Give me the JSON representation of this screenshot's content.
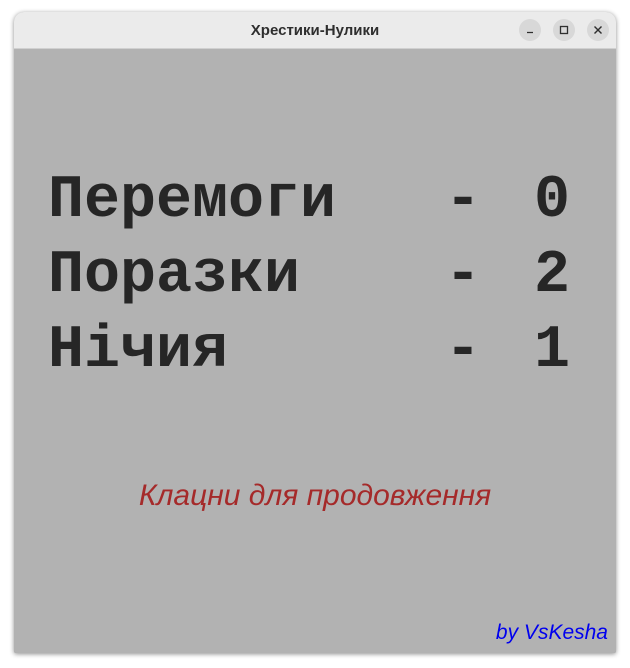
{
  "window": {
    "title": "Хрестики-Нулики"
  },
  "stats": [
    {
      "label": "Перемоги",
      "dash": "-",
      "value": "0"
    },
    {
      "label": "Поразки",
      "dash": "-",
      "value": "2"
    },
    {
      "label": "Нічия",
      "dash": "-",
      "value": "1"
    }
  ],
  "prompt": "Клацни для продовження",
  "credit": "by VsKesha",
  "colors": {
    "background": "#b2b2b2",
    "stat_text": "#262626",
    "prompt": "#a52a2a",
    "credit": "#0000ee"
  },
  "icons": {
    "minimize": "minimize-icon",
    "maximize": "maximize-icon",
    "close": "close-icon"
  }
}
